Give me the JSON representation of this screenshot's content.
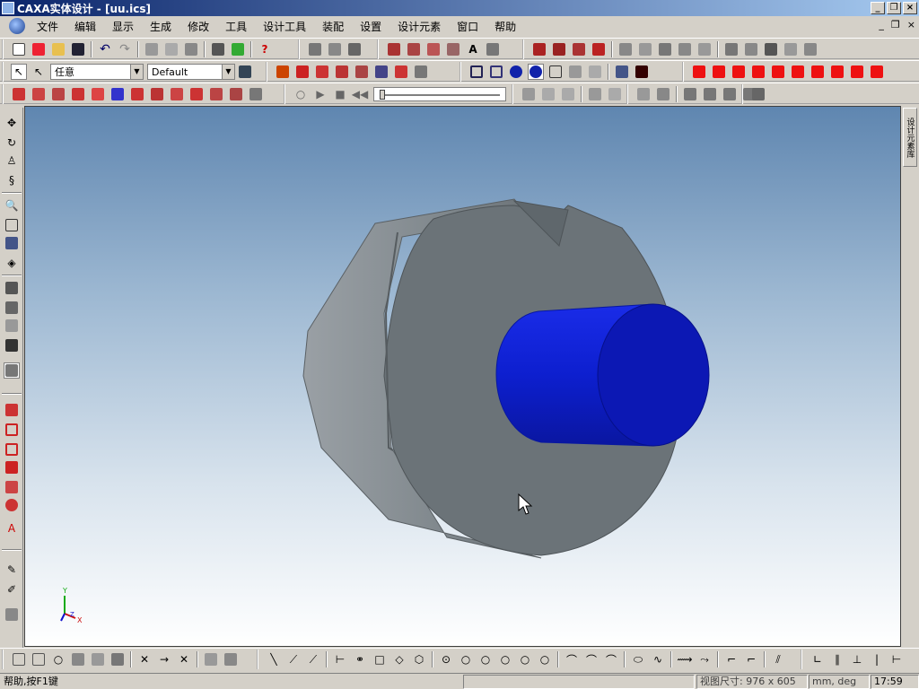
{
  "window": {
    "title": "CAXA实体设计 - [uu.ics]",
    "minimize": "_",
    "restore": "❐",
    "close": "×"
  },
  "menu": {
    "items": [
      "文件",
      "编辑",
      "显示",
      "生成",
      "修改",
      "工具",
      "设计工具",
      "装配",
      "设置",
      "设计元素",
      "窗口",
      "帮助"
    ],
    "mdi_minimize": "_",
    "mdi_restore": "❐",
    "mdi_close": "×"
  },
  "toolbar2": {
    "selection_combo": "任意",
    "style_combo": "Default"
  },
  "right_panel": {
    "tab_label": "设计元素库"
  },
  "triad": {
    "x": "X",
    "y": "Y",
    "z": "Z"
  },
  "status": {
    "help": "帮助,按F1键",
    "viewport_size": "视图尺寸: 976 x 605",
    "units": "mm, deg",
    "time": "17:59"
  },
  "colors": {
    "part_body": "#6b7378",
    "cylinder": "#0a1ec8",
    "titlebar": "#0a246a"
  }
}
